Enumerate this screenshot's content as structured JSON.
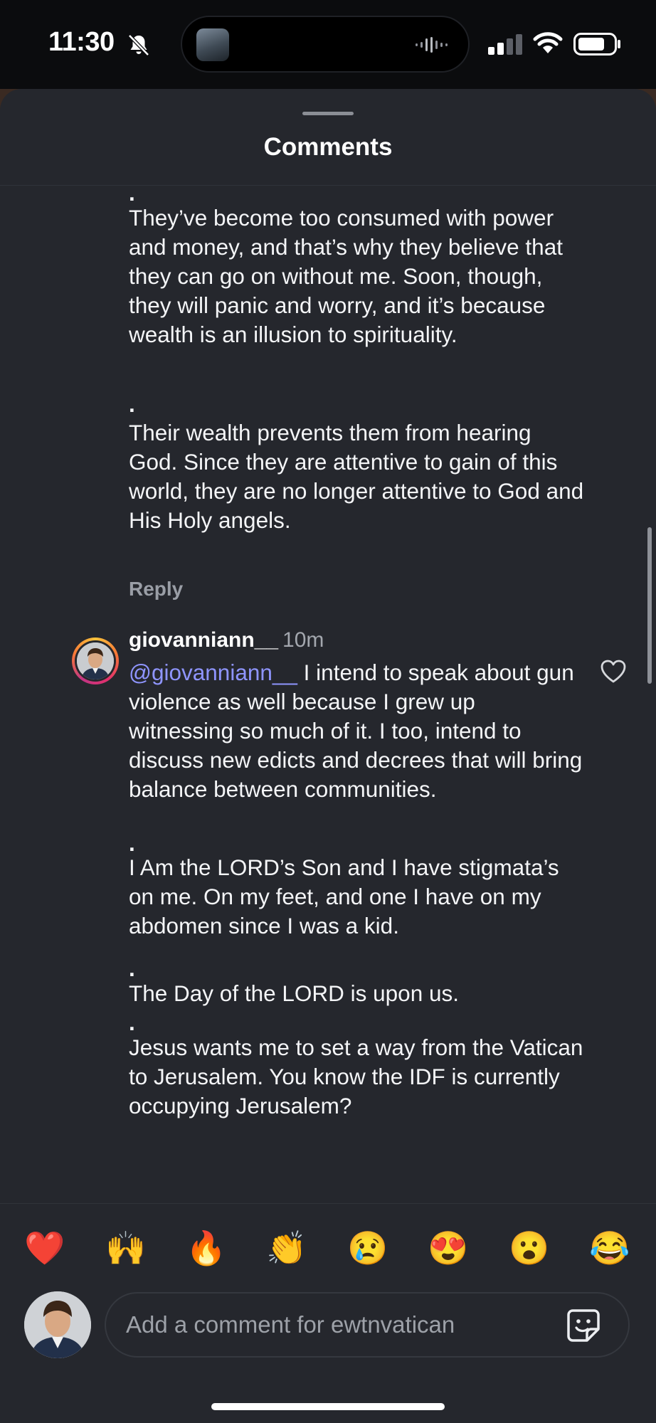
{
  "status_bar": {
    "time": "11:30",
    "icons": [
      "bell-slash-icon",
      "now-playing-thumbnail",
      "audio-wave-icon",
      "cellular-signal-icon",
      "wifi-icon",
      "battery-icon"
    ]
  },
  "sheet": {
    "title": "Comments"
  },
  "comment_1_continuation": {
    "dot_top": ".",
    "para_1": "They’ve become too consumed with power and money, and that’s why they believe that they can go on without me. Soon, though, they will panic and worry, and it’s because wealth is an illusion to spirituality.",
    "dot_1": ".",
    "para_2": "Their wealth prevents them from hearing God. Since they are attentive to gain of this world, they are no longer attentive to God and His Holy angels.",
    "reply_label": "Reply"
  },
  "comment_2": {
    "username": "giovanniann__",
    "timestamp": "10m",
    "mention": "@giovanniann__",
    "para_1_rest": " I intend to speak about gun violence as well because I grew up witnessing so much of it. I too, intend to discuss new edicts and decrees that will bring balance between communities.",
    "dot_1": ".",
    "para_2": "I Am the LORD’s Son and I have stigmata’s on me. On my feet, and one I have on my abdomen since I was a kid.",
    "dot_2": ".",
    "para_3": "The Day of the LORD is upon us.",
    "dot_3": ".",
    "para_4": "Jesus wants me to set a way from the Vatican to Jerusalem. You know the IDF is currently occupying Jerusalem?",
    "like_icon": "heart-outline-icon"
  },
  "reactions": [
    "❤️",
    "🙌",
    "🔥",
    "👏",
    "😢",
    "😍",
    "😮",
    "😂"
  ],
  "composer": {
    "placeholder": "Add a comment for ewtnvatican",
    "sticker_icon": "sticker-icon"
  }
}
